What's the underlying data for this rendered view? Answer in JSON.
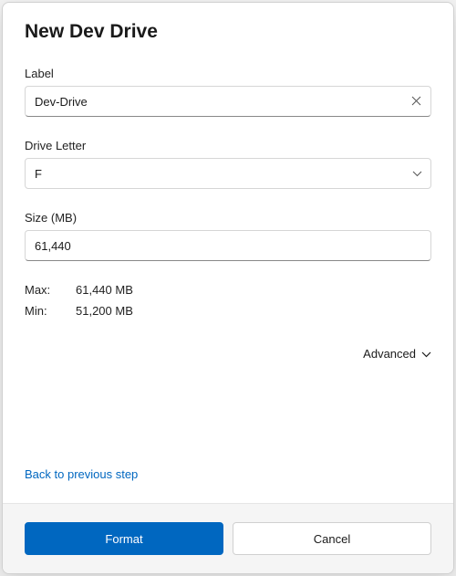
{
  "title": "New Dev Drive",
  "fields": {
    "label": {
      "label": "Label",
      "value": "Dev-Drive"
    },
    "drive_letter": {
      "label": "Drive Letter",
      "value": "F"
    },
    "size": {
      "label": "Size (MB)",
      "value": "61,440"
    }
  },
  "info": {
    "max_label": "Max:",
    "max_value": "61,440 MB",
    "min_label": "Min:",
    "min_value": "51,200 MB"
  },
  "advanced_label": "Advanced",
  "back_link": "Back to previous step",
  "buttons": {
    "format": "Format",
    "cancel": "Cancel"
  }
}
